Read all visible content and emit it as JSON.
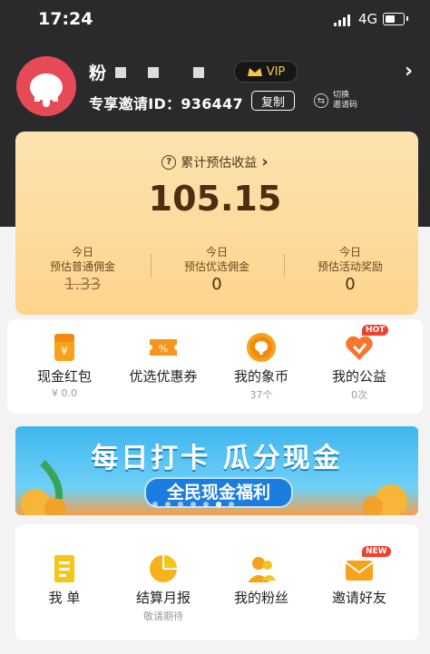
{
  "status_bar": {
    "time": "17:24",
    "network": "4G"
  },
  "profile": {
    "name_prefix": "粉",
    "vip_label": "VIP",
    "invite_prefix": "专享邀请ID：",
    "invite_id": "936447",
    "copy_label": "复制",
    "switch_line1": "切换",
    "switch_line2": "邀请码"
  },
  "earnings": {
    "title": "累计预估收益",
    "total": "105.15",
    "stats": [
      {
        "line1": "今日",
        "line2": "预估普通佣金",
        "value": "1.33"
      },
      {
        "line1": "今日",
        "line2": "预估优选佣金",
        "value": "0"
      },
      {
        "line1": "今日",
        "line2": "预估活动奖励",
        "value": "0"
      }
    ]
  },
  "menu_top": [
    {
      "label": "现金红包",
      "sub": "¥ 0.0"
    },
    {
      "label": "优选优惠券",
      "sub": ""
    },
    {
      "label": "我的象币",
      "sub": "37个"
    },
    {
      "label": "我的公益",
      "sub": "0次",
      "badge": "HOT"
    }
  ],
  "banner": {
    "title": "每日打卡 瓜分现金",
    "pill": "全民现金福利"
  },
  "menu_bottom": [
    {
      "label": "我  单",
      "sub": ""
    },
    {
      "label": "结算月报",
      "sub": "敬请期待"
    },
    {
      "label": "我的粉丝",
      "sub": ""
    },
    {
      "label": "邀请好友",
      "sub": "",
      "badge": "NEW"
    }
  ],
  "colors": {
    "header_bg": "#2a2a2c",
    "card_gold": "#fdd58c",
    "accent_orange": "#f7a21b",
    "badge_red": "#f0412f"
  }
}
